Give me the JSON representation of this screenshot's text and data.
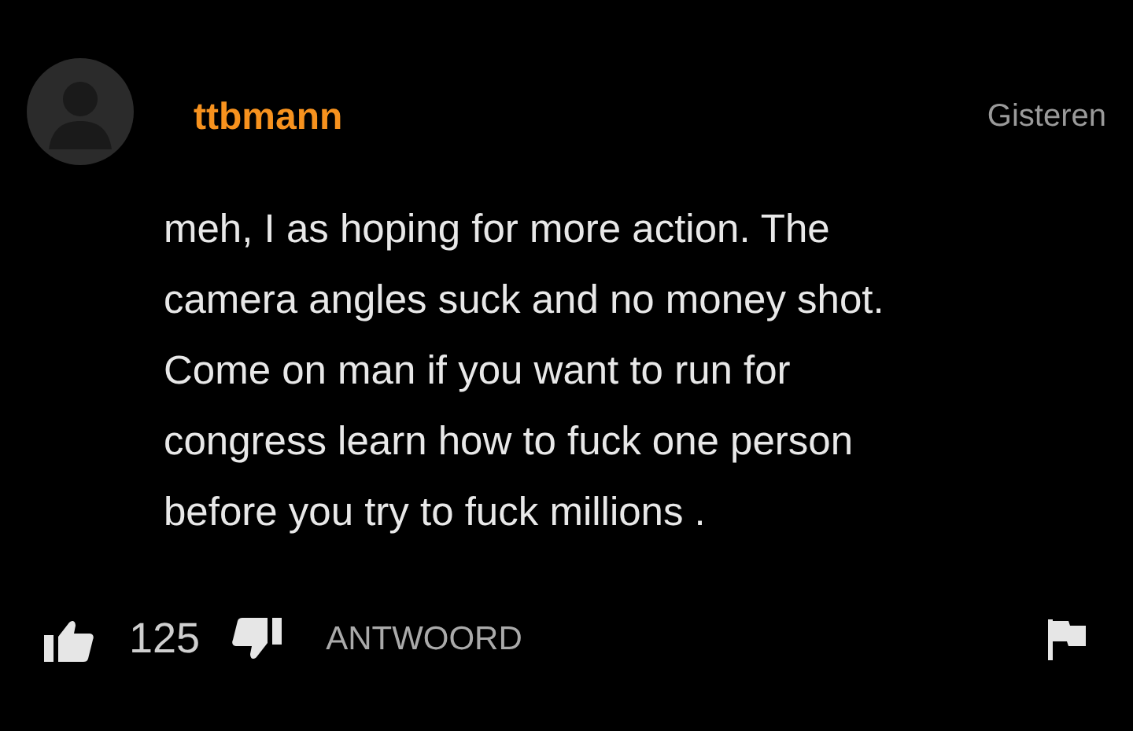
{
  "comment": {
    "author": "ttbmann",
    "time": "Gisteren",
    "text": "meh, I as hoping for more action. The\ncamera angles suck and no money shot.\nCome on man if you want to run for\ncongress learn how to fuck one person\nbefore you try to fuck millions .",
    "likes": "125",
    "reply": "ANTWOORD"
  }
}
